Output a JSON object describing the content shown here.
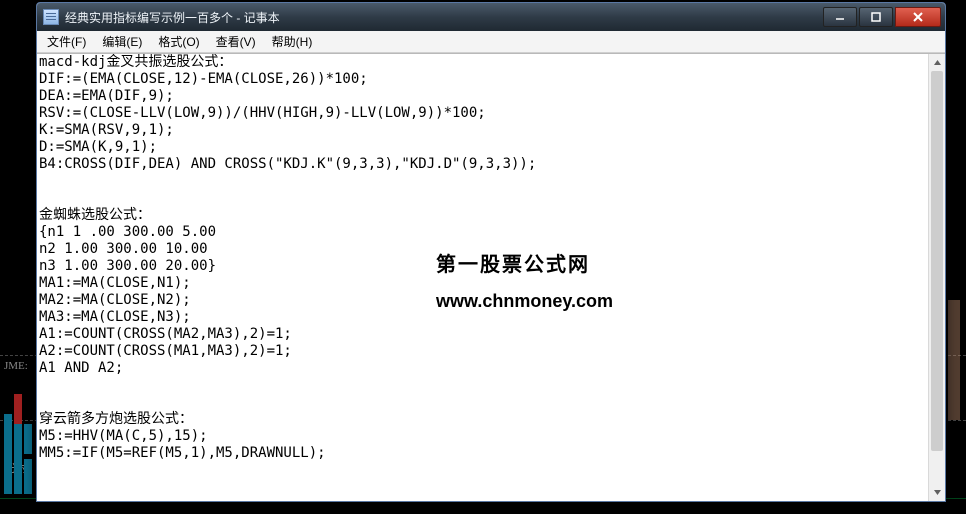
{
  "window": {
    "title": "经典实用指标编写示例一百多个 - 记事本"
  },
  "menu": {
    "file": "文件(F)",
    "edit": "编辑(E)",
    "format": "格式(O)",
    "view": "查看(V)",
    "help": "帮助(H)"
  },
  "background": {
    "label_volume": "JME:",
    "label_period": "分时"
  },
  "watermark": {
    "line1": "第一股票公式网",
    "line2": "www.chnmoney.com"
  },
  "document": {
    "text": "macd-kdj金叉共振选股公式：\nDIF:=(EMA(CLOSE,12)-EMA(CLOSE,26))*100;\nDEA:=EMA(DIF,9);\nRSV:=(CLOSE-LLV(LOW,9))/(HHV(HIGH,9)-LLV(LOW,9))*100;\nK:=SMA(RSV,9,1);\nD:=SMA(K,9,1);\nB4:CROSS(DIF,DEA) AND CROSS(\"KDJ.K\"(9,3,3),\"KDJ.D\"(9,3,3));\n\n\n金蜘蛛选股公式：\n{n1 1 .00 300.00 5.00\nn2 1.00 300.00 10.00\nn3 1.00 300.00 20.00}\nMA1:=MA(CLOSE,N1);\nMA2:=MA(CLOSE,N2);\nMA3:=MA(CLOSE,N3);\nA1:=COUNT(CROSS(MA2,MA3),2)=1;\nA2:=COUNT(CROSS(MA1,MA3),2)=1;\nA1 AND A2;\n\n\n穿云箭多方炮选股公式：\nM5:=HHV(MA(C,5),15);\nMM5:=IF(M5=REF(M5,1),M5,DRAWNULL);"
  }
}
